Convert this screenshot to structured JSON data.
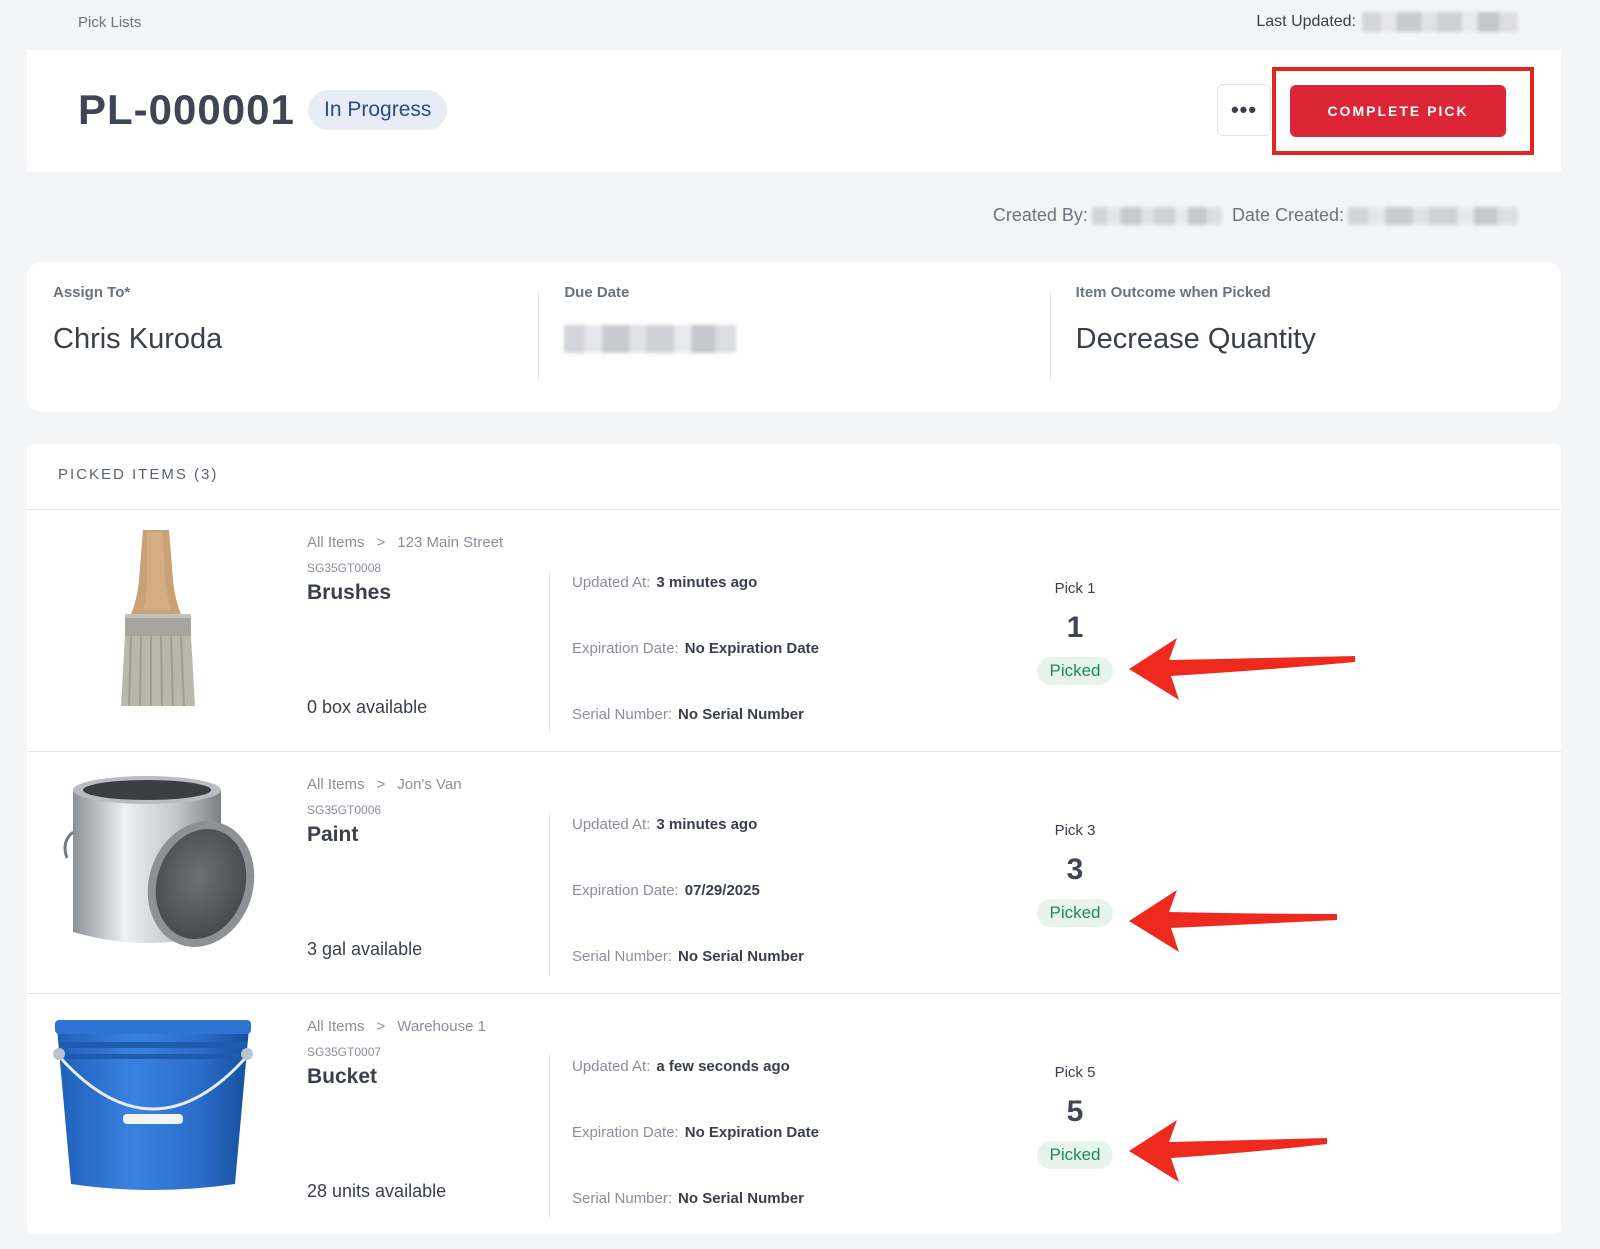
{
  "breadcrumb": "Pick Lists",
  "last_updated_label": "Last Updated:",
  "header": {
    "title": "PL-000001",
    "status": "In Progress",
    "more_label": "•••",
    "complete_label": "COMPLETE PICK"
  },
  "meta": {
    "created_by_label": "Created By:",
    "date_created_label": "Date Created:"
  },
  "fields": {
    "assign_label": "Assign To*",
    "assign_value": "Chris Kuroda",
    "due_label": "Due Date",
    "outcome_label": "Item Outcome when Picked",
    "outcome_value": "Decrease Quantity"
  },
  "items_heading": "PICKED ITEMS (3)",
  "detail_labels": {
    "updated": "Updated At:",
    "expiration": "Expiration Date:",
    "serial": "Serial Number:"
  },
  "items": [
    {
      "crumb_root": "All Items",
      "crumb_sep": ">",
      "location": "123 Main Street",
      "sku": "SG35GT0008",
      "name": "Brushes",
      "available": "0 box available",
      "updated": "3 minutes ago",
      "expiration": "No Expiration Date",
      "serial": "No Serial Number",
      "pick_label": "Pick 1",
      "qty": "1",
      "status": "Picked"
    },
    {
      "crumb_root": "All Items",
      "crumb_sep": ">",
      "location": "Jon's Van",
      "sku": "SG35GT0006",
      "name": "Paint",
      "available": "3 gal available",
      "updated": "3 minutes ago",
      "expiration": "07/29/2025",
      "serial": "No Serial Number",
      "pick_label": "Pick 3",
      "qty": "3",
      "status": "Picked"
    },
    {
      "crumb_root": "All Items",
      "crumb_sep": ">",
      "location": "Warehouse 1",
      "sku": "SG35GT0007",
      "name": "Bucket",
      "available": "28 units available",
      "updated": "a few seconds ago",
      "expiration": "No Expiration Date",
      "serial": "No Serial Number",
      "pick_label": "Pick 5",
      "qty": "5",
      "status": "Picked"
    }
  ],
  "colors": {
    "primary": "#dc2637",
    "highlight": "#e3261d",
    "status_pill_bg": "#e8ecf5",
    "picked_bg": "#e7f4ee",
    "picked_text": "#1f8a5b"
  }
}
